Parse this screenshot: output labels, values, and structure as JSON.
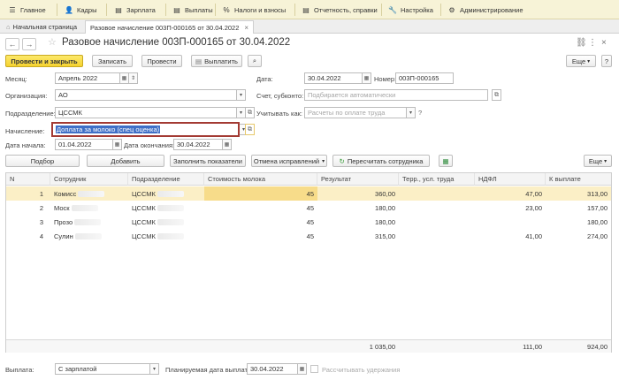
{
  "menu": [
    {
      "icon": "☰",
      "icon_name": "menu-icon",
      "label": "Главное"
    },
    {
      "icon": "👤",
      "icon_name": "personnel-icon",
      "label": "Кадры"
    },
    {
      "icon": "▤",
      "icon_name": "salary-icon",
      "label": "Зарплата"
    },
    {
      "icon": "▤",
      "icon_name": "payments-icon",
      "label": "Выплаты"
    },
    {
      "icon": "%",
      "icon_name": "taxes-icon",
      "label": "Налоги и взносы"
    },
    {
      "icon": "▤",
      "icon_name": "reports-icon",
      "label": "Отчетность, справки"
    },
    {
      "icon": "🔧",
      "icon_name": "settings-icon",
      "label": "Настройка"
    },
    {
      "icon": "⚙",
      "icon_name": "admin-icon",
      "label": "Администрирование"
    }
  ],
  "tabs": {
    "home": "Начальная страница",
    "document": "Разовое начисление 003П-000165 от 30.04.2022"
  },
  "header": {
    "title": "Разовое начисление 003П-000165 от 30.04.2022"
  },
  "toolbar": {
    "post_close": "Провести и закрыть",
    "save": "Записать",
    "post": "Провести",
    "pay": "Выплатить",
    "more": "Еще"
  },
  "form": {
    "month_label": "Месяц:",
    "month_value": "Апрель 2022",
    "date_label": "Дата:",
    "date_value": "30.04.2022",
    "number_label": "Номер:",
    "number_value": "003П-000165",
    "org_label": "Организация:",
    "org_value": "АО",
    "account_label": "Счет, субконто:",
    "account_placeholder": "Подбирается автоматически",
    "dept_label": "Подразделение:",
    "dept_value": "ЦССМК",
    "consider_label": "Учитывать как:",
    "consider_placeholder": "Расчеты по оплате труда",
    "help": "?",
    "accrual_label": "Начисление:",
    "accrual_value": "Доплата за молоко (спец оценка)",
    "start_label": "Дата начала:",
    "start_value": "01.04.2022",
    "end_label": "Дата окончания:",
    "end_value": "30.04.2022"
  },
  "table_toolbar": {
    "select": "Подбор",
    "add": "Добавить",
    "fill": "Заполнить показатели",
    "cancel": "Отмена исправлений",
    "recalc": "Пересчитать сотрудника",
    "more": "Еще"
  },
  "table": {
    "columns": [
      "N",
      "Сотрудник",
      "Подразделение",
      "Стоимость молока",
      "Результат",
      "Терр., усл. труда",
      "НДФЛ",
      "К выплате"
    ],
    "rows": [
      {
        "n": "1",
        "employee": "Комисс",
        "dept": "ЦССМК",
        "milk": "45",
        "result": "360,00",
        "terr": "",
        "ndfl": "47,00",
        "pay": "313,00"
      },
      {
        "n": "2",
        "employee": "Моск",
        "dept": "ЦССМК",
        "milk": "45",
        "result": "180,00",
        "terr": "",
        "ndfl": "23,00",
        "pay": "157,00"
      },
      {
        "n": "3",
        "employee": "Прозо",
        "dept": "ЦССМК",
        "milk": "45",
        "result": "180,00",
        "terr": "",
        "ndfl": "",
        "pay": "180,00"
      },
      {
        "n": "4",
        "employee": "Сулин",
        "dept": "ЦССМК",
        "milk": "45",
        "result": "315,00",
        "terr": "",
        "ndfl": "41,00",
        "pay": "274,00"
      }
    ],
    "totals": {
      "result": "1 035,00",
      "ndfl": "111,00",
      "pay": "924,00"
    }
  },
  "bottom": {
    "payout_label": "Выплата:",
    "payout_value": "С зарплатой",
    "planned_label": "Планируемая дата выплаты:",
    "planned_value": "30.04.2022",
    "withhold_label": "Рассчитывать удержания"
  },
  "colors": {
    "menubar": "#f7f3d7",
    "primary_button": "#f5d22f",
    "selected_row": "#fbefc6",
    "highlight_field": "#a33a33"
  }
}
